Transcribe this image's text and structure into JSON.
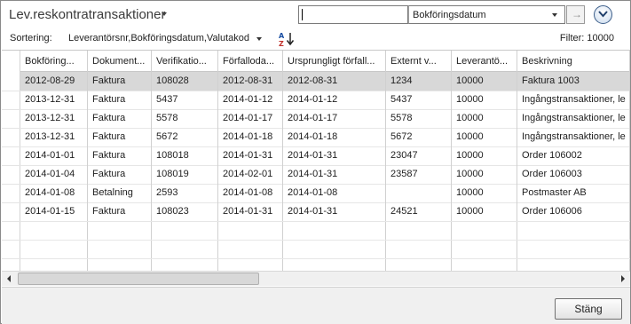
{
  "header": {
    "title": "Lev.reskontratransaktioner",
    "search_value": "",
    "search_field": "Bokföringsdatum",
    "go_icon": "arrow-right-icon",
    "expand_icon": "chevron-down-circle-icon"
  },
  "sort": {
    "label": "Sortering:",
    "value": "Leverantörsnr,Bokföringsdatum,Valutakod",
    "icon": "sort-az-icon",
    "filter_count": "Filter: 10000"
  },
  "columns": [
    "Bokföring...",
    "Dokument...",
    "Verifikatio...",
    "Förfalloda...",
    "Ursprungligt förfall...",
    "Externt v...",
    "Leverantö...",
    "Beskrivning"
  ],
  "rows": [
    [
      "2012-08-29",
      "Faktura",
      "108028",
      "2012-08-31",
      "2012-08-31",
      "1234",
      "10000",
      "Faktura 1003"
    ],
    [
      "2013-12-31",
      "Faktura",
      "5437",
      "2014-01-12",
      "2014-01-12",
      "5437",
      "10000",
      "Ingångstransaktioner, le"
    ],
    [
      "2013-12-31",
      "Faktura",
      "5578",
      "2014-01-17",
      "2014-01-17",
      "5578",
      "10000",
      "Ingångstransaktioner, le"
    ],
    [
      "2013-12-31",
      "Faktura",
      "5672",
      "2014-01-18",
      "2014-01-18",
      "5672",
      "10000",
      "Ingångstransaktioner, le"
    ],
    [
      "2014-01-01",
      "Faktura",
      "108018",
      "2014-01-31",
      "2014-01-31",
      "23047",
      "10000",
      "Order 106002"
    ],
    [
      "2014-01-04",
      "Faktura",
      "108019",
      "2014-02-01",
      "2014-01-31",
      "23587",
      "10000",
      "Order 106003"
    ],
    [
      "2014-01-08",
      "Betalning",
      "2593",
      "2014-01-08",
      "2014-01-08",
      "",
      "10000",
      "Postmaster AB"
    ],
    [
      "2014-01-15",
      "Faktura",
      "108023",
      "2014-01-31",
      "2014-01-31",
      "24521",
      "10000",
      "Order 106006"
    ]
  ],
  "selected_row": 0,
  "footer": {
    "close_label": "Stäng"
  }
}
